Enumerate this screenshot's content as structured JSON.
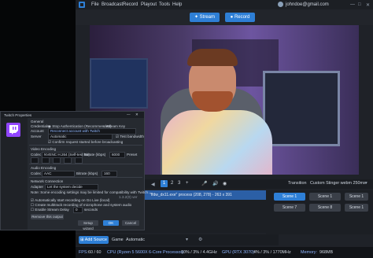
{
  "menu": {
    "items": [
      "File",
      "Broadcast",
      "Record",
      "Playout",
      "Tools",
      "Help"
    ],
    "user": "johndoe@gmail.com"
  },
  "toolbar": {
    "stream_label": "Stream",
    "record_label": "Record"
  },
  "source": {
    "label": "\"ffdw_dx11.exe\" process (208, 278) - 263 x 391"
  },
  "scenes": [
    {
      "label": "Scene 1",
      "active": true
    },
    {
      "label": "Scene 1",
      "active": false
    },
    {
      "label": "Scene 1",
      "active": false
    },
    {
      "label": "Scene 7",
      "active": false
    },
    {
      "label": "Scene 8",
      "active": false
    },
    {
      "label": "Scene 1",
      "active": false
    }
  ],
  "transition": {
    "label": "Transition",
    "value": "Custom Stinger webm 250ms"
  },
  "pager": {
    "pages": [
      "1",
      "2",
      "3"
    ],
    "active": "1"
  },
  "bottom": {
    "add_source": "Add Source",
    "game_label": "Game",
    "game_value": "Automatic"
  },
  "status": {
    "fps_label": "FPS:",
    "fps_value": "60 / 60",
    "cpu_label": "CPU (Ryzen 5 5600X 6-Core Processor):",
    "cpu_value": "10% / 3% / 4.4GHz",
    "gpu_label": "GPU (RTX 3070):",
    "gpu_value": "4% / 3% / 1770MHz",
    "mem_label": "Memory:",
    "mem_value": "968MB"
  },
  "dialog": {
    "title": "Twitch Properties",
    "general_head": "General",
    "credentials_label": "Credentials",
    "credentials_opt1": "Stop Authentication (Recommended)",
    "credentials_opt2": "Stream Key",
    "account_label": "Account",
    "account_value": "Reconnect account with Twitch",
    "server_label": "Server",
    "server_value": "Automatic",
    "test_bandwidth": "Test bandwidth",
    "confirm_label": "Confirm request started before broadcasting",
    "video_head": "Video Encoding",
    "codec_label": "Codec",
    "codec_value": "NVENC H.264 (Self-test hw)",
    "bitrate_label": "Bitrate (kbps)",
    "bitrate_value": "6000",
    "preset_label": "Preset",
    "audio_head": "Audio Encoding",
    "audio_codec_label": "Codec",
    "audio_codec_value": "AAC",
    "audio_bitrate_label": "Bitrate (kbps)",
    "audio_bitrate_value": "160",
    "network_head": "Network Connection",
    "adapter_label": "Adapter",
    "adapter_value": "Let the system decide",
    "note": "Note: Some encoding settings may be limited for compatibility with Twitch.",
    "version": "1.3.2(0) ver",
    "autostart": "Automatically start recording on Go Live (local)",
    "record_separate": "Create multitrack recording of microphone and system audio",
    "enable_delay": "Enable Stream Delay",
    "delay_value": "0",
    "seconds": "seconds",
    "setup_wizard": "Setup wizard",
    "ok": "OK",
    "cancel": "Cancel",
    "remove": "Remove this output"
  }
}
